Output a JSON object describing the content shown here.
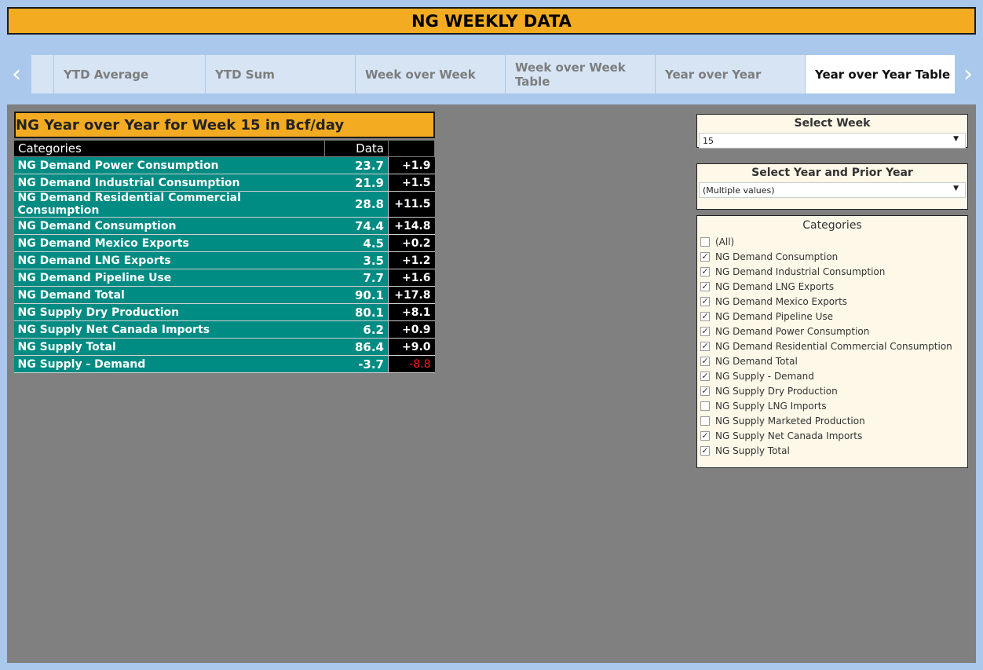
{
  "header": {
    "title": "NG WEEKLY DATA"
  },
  "tabs": [
    {
      "label": ""
    },
    {
      "label": "YTD Average"
    },
    {
      "label": "YTD Sum"
    },
    {
      "label": "Week over Week"
    },
    {
      "label": "Week over Week Table"
    },
    {
      "label": "Year over Year"
    },
    {
      "label": "Year over Year Table",
      "active": true
    }
  ],
  "nav": {
    "left_icon": "‹",
    "right_icon": "›"
  },
  "table": {
    "title": "NG Year over Year for Week 15 in Bcf/day",
    "col_category": "Categories",
    "col_data": "Data",
    "col_change": "",
    "rows": [
      {
        "category": "NG Demand Power Consumption",
        "value": "23.7",
        "change": "+1.9"
      },
      {
        "category": "NG Demand Industrial Consumption",
        "value": "21.9",
        "change": "+1.5"
      },
      {
        "category": "NG Demand Residential Commercial Consumption",
        "value": "28.8",
        "change": "+11.5"
      },
      {
        "category": "NG Demand Consumption",
        "value": "74.4",
        "change": "+14.8"
      },
      {
        "category": "NG Demand Mexico Exports",
        "value": "4.5",
        "change": "+0.2"
      },
      {
        "category": "NG Demand LNG Exports",
        "value": "3.5",
        "change": "+1.2"
      },
      {
        "category": "NG Demand Pipeline Use",
        "value": "7.7",
        "change": "+1.6"
      },
      {
        "category": "NG Demand Total",
        "value": "90.1",
        "change": "+17.8"
      },
      {
        "category": "NG Supply Dry Production",
        "value": "80.1",
        "change": "+8.1"
      },
      {
        "category": "NG Supply Net Canada Imports",
        "value": "6.2",
        "change": "+0.9"
      },
      {
        "category": "NG Supply Total",
        "value": "86.4",
        "change": "+9.0"
      },
      {
        "category": "NG Supply - Demand",
        "value": "-3.7",
        "change": "-8.8",
        "negative": true
      }
    ]
  },
  "filters": {
    "week": {
      "title": "Select Week",
      "value": "15"
    },
    "year": {
      "title": "Select Year and Prior Year",
      "value": "(Multiple values)"
    },
    "categories": {
      "title": "Categories",
      "items": [
        {
          "label": "(All)",
          "checked": false
        },
        {
          "label": "NG Demand Consumption",
          "checked": true
        },
        {
          "label": "NG Demand Industrial Consumption",
          "checked": true
        },
        {
          "label": "NG Demand LNG Exports",
          "checked": true
        },
        {
          "label": "NG Demand Mexico Exports",
          "checked": true
        },
        {
          "label": "NG Demand Pipeline Use",
          "checked": true
        },
        {
          "label": "NG Demand Power Consumption",
          "checked": true
        },
        {
          "label": "NG Demand Residential Commercial Consumption",
          "checked": true
        },
        {
          "label": "NG Demand Total",
          "checked": true
        },
        {
          "label": "NG Supply - Demand",
          "checked": true
        },
        {
          "label": "NG Supply Dry Production",
          "checked": true
        },
        {
          "label": "NG Supply LNG Imports",
          "checked": false
        },
        {
          "label": "NG Supply Marketed Production",
          "checked": false
        },
        {
          "label": "NG Supply Net Canada Imports",
          "checked": true
        },
        {
          "label": "NG Supply Total",
          "checked": true
        }
      ]
    }
  },
  "colors": {
    "header_bg": "#f3ac22",
    "teal": "#008b83",
    "negative": "#ff1a1a",
    "canvas": "#808080",
    "page_bg": "#a9c8ec"
  }
}
